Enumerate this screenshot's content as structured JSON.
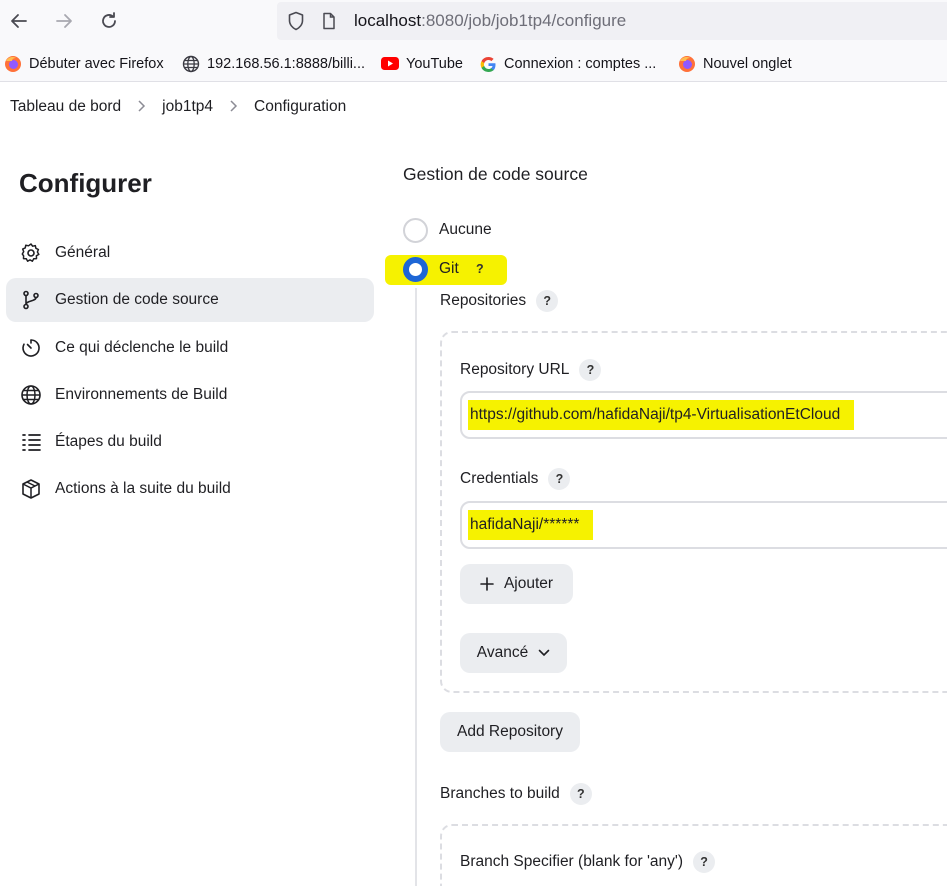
{
  "browser": {
    "url_host": "localhost",
    "url_path": ":8080/job/job1tp4/configure",
    "back_icon": "arrow-left-icon",
    "forward_icon": "arrow-right-icon",
    "reload_icon": "reload-icon"
  },
  "bookmarks": [
    {
      "label": "Débuter avec Firefox",
      "icon": "firefox-icon"
    },
    {
      "label": "192.168.56.1:8888/billi...",
      "icon": "globe-icon"
    },
    {
      "label": "YouTube",
      "icon": "youtube-icon"
    },
    {
      "label": "Connexion : comptes ...",
      "icon": "google-icon"
    },
    {
      "label": "Nouvel onglet",
      "icon": "firefox-icon"
    }
  ],
  "breadcrumb": [
    "Tableau de bord",
    "job1tp4",
    "Configuration"
  ],
  "sidebar": {
    "title": "Configurer",
    "items": [
      {
        "label": "Général",
        "icon": "gear-icon",
        "active": false
      },
      {
        "label": "Gestion de code source",
        "icon": "branch-icon",
        "active": true
      },
      {
        "label": "Ce qui déclenche le build",
        "icon": "timer-icon",
        "active": false
      },
      {
        "label": "Environnements de Build",
        "icon": "globe-icon",
        "active": false
      },
      {
        "label": "Étapes du build",
        "icon": "list-icon",
        "active": false
      },
      {
        "label": "Actions à la suite du build",
        "icon": "package-icon",
        "active": false
      }
    ]
  },
  "scm": {
    "title": "Gestion de code source",
    "option_none": "Aucune",
    "option_git": "Git",
    "help": "?",
    "repositories_label": "Repositories",
    "repo_url_label": "Repository URL",
    "repo_url_value": "https://github.com/hafidaNaji/tp4-VirtualisationEtCloud",
    "credentials_label": "Credentials",
    "credentials_value": "hafidaNaji/******",
    "add_button": "Ajouter",
    "advanced_button": "Avancé",
    "add_repository_button": "Add Repository",
    "branches_label": "Branches to build",
    "branch_specifier_label": "Branch Specifier (blank for 'any')"
  },
  "colors": {
    "highlight": "#f6f200",
    "accent": "#1d66d6"
  }
}
